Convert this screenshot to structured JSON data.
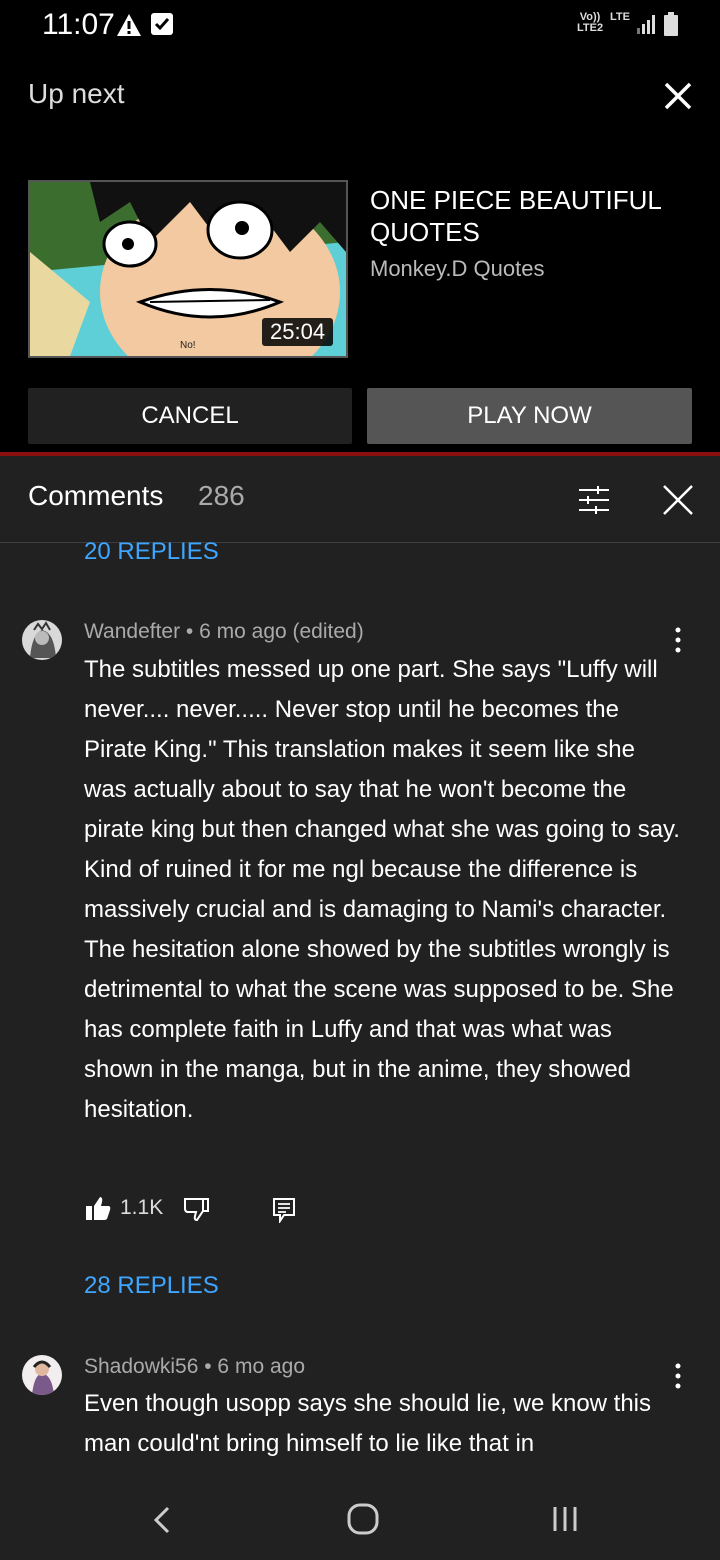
{
  "status_bar": {
    "time": "11:07",
    "volte_top": "Vo))",
    "volte_bottom": "LTE2",
    "lte": "LTE"
  },
  "up_next": {
    "label": "Up next",
    "video": {
      "title": "ONE PIECE BEAUTIFUL QUOTES",
      "channel": "Monkey.D Quotes",
      "duration": "25:04",
      "thumb_caption": "No!"
    },
    "cancel_label": "CANCEL",
    "play_label": "PLAY NOW"
  },
  "comments": {
    "title": "Comments",
    "count": "286",
    "prev_replies": "20 REPLIES",
    "items": [
      {
        "author": "Wandefter",
        "meta": "Wandefter • 6 mo ago (edited)",
        "text": "The subtitles messed up one part. She says \"Luffy will never.... never..... Never stop until he becomes the Pirate King.\" This translation makes it seem like she was actually about to say that he won't become the pirate king but then changed what she was going to say. Kind of ruined it for me ngl because the difference is massively crucial and is damaging to Nami's character. The hesitation alone showed by the subtitles wrongly is detrimental to what the scene was supposed to be. She has complete faith in Luffy and that was what was shown in the manga, but in the anime, they showed hesitation.",
        "likes": "1.1K",
        "replies": "28 REPLIES"
      },
      {
        "author": "Shadowki56",
        "meta": "Shadowki56 • 6 mo ago",
        "text": "Even though usopp says she should lie, we know this man could'nt bring himself to lie like that in"
      }
    ]
  },
  "colors": {
    "panel_bg": "#212121",
    "link_blue": "#3ea6ff",
    "accent_red": "#8b0f0f",
    "play_button": "#555555"
  }
}
